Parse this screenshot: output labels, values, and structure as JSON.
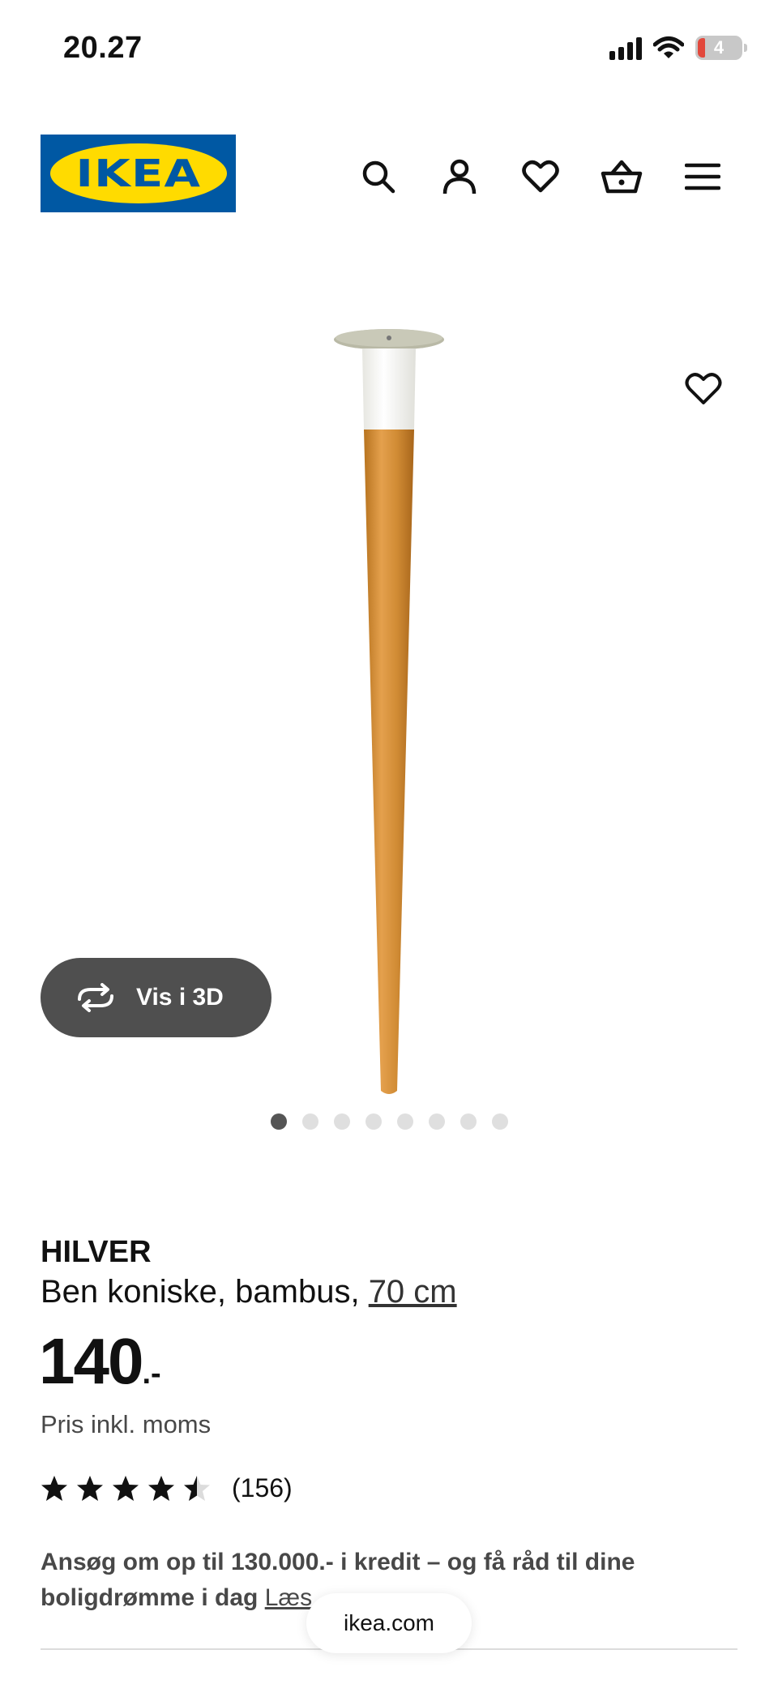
{
  "status_bar": {
    "time": "20.27",
    "battery_level": "4",
    "icons": [
      "signal-icon",
      "wifi-icon",
      "battery-icon"
    ]
  },
  "header": {
    "logo_text": "IKEA",
    "icons": [
      "search-icon",
      "account-icon",
      "heart-icon",
      "basket-icon",
      "menu-icon"
    ]
  },
  "gallery": {
    "view_3d_label": "Vis i 3D",
    "dots_total": 8,
    "active_dot": 1
  },
  "product": {
    "name": "HILVER",
    "description": "Ben koniske, bambus,",
    "size_link": "70 cm",
    "price": "140",
    "price_suffix": ".-",
    "price_note": "Pris inkl. moms",
    "rating_value": 4.5,
    "rating_max": 5,
    "review_count": "(156)"
  },
  "promo": {
    "text": "Ansøg om op til 130.000.- i kredit – og få råd til dine boligdrømme i dag",
    "link_label": "Læs"
  },
  "browser": {
    "url": "ikea.com"
  },
  "colors": {
    "ikea_blue": "#0058a3",
    "ikea_yellow": "#ffdb00",
    "button_dark": "#4f4f4f",
    "text": "#111111",
    "muted_text": "#484848"
  }
}
